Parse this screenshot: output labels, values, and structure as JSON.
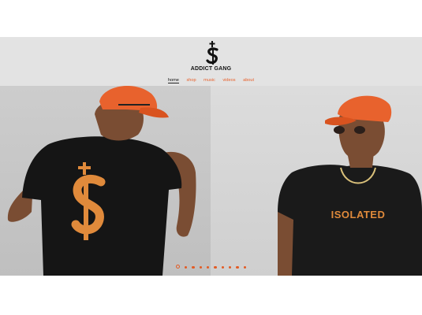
{
  "brand": {
    "name": "ADDICT GANG",
    "logo_icon": "cross-dollar-logo-icon"
  },
  "nav": {
    "items": [
      "home",
      "shop",
      "music",
      "videos",
      "about"
    ],
    "active": "home"
  },
  "hero": {
    "shirt_text": "ISOLATED",
    "accent_color": "#e8622d"
  },
  "slider": {
    "count": 10,
    "active_index": 0
  }
}
